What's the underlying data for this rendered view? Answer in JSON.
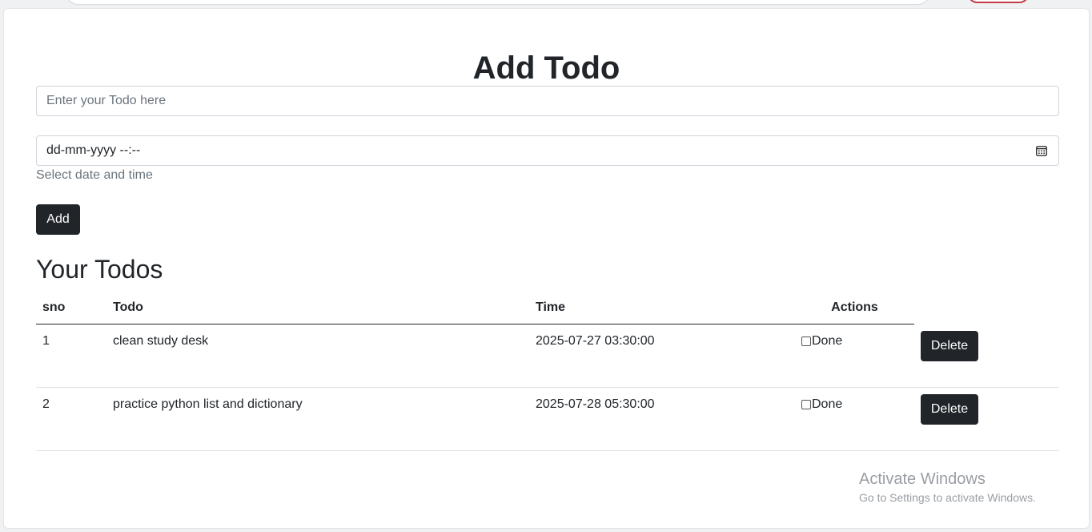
{
  "page": {
    "title": "Add Todo"
  },
  "form": {
    "todo_placeholder": "Enter your Todo here",
    "datetime_value": "dd-mm-yyyy --:--",
    "datetime_help": "Select date and time",
    "add_label": "Add"
  },
  "list": {
    "title": "Your Todos",
    "columns": [
      "sno",
      "Todo",
      "Time",
      "Actions"
    ],
    "rows": [
      {
        "sno": "1",
        "todo": "clean study desk",
        "time": "2025-07-27 03:30:00",
        "done_label": "Done",
        "done": false,
        "delete_label": "Delete"
      },
      {
        "sno": "2",
        "todo": "practice python list and dictionary",
        "time": "2025-07-28 05:30:00",
        "done_label": "Done",
        "done": false,
        "delete_label": "Delete"
      }
    ]
  },
  "watermark": {
    "title": "Activate Windows",
    "subtitle": "Go to Settings to activate Windows."
  },
  "colors": {
    "primary_button": "#212529",
    "muted_text": "#6c757d",
    "border": "#ced4da"
  },
  "icons": {
    "datetime_picker": "calendar-icon"
  }
}
